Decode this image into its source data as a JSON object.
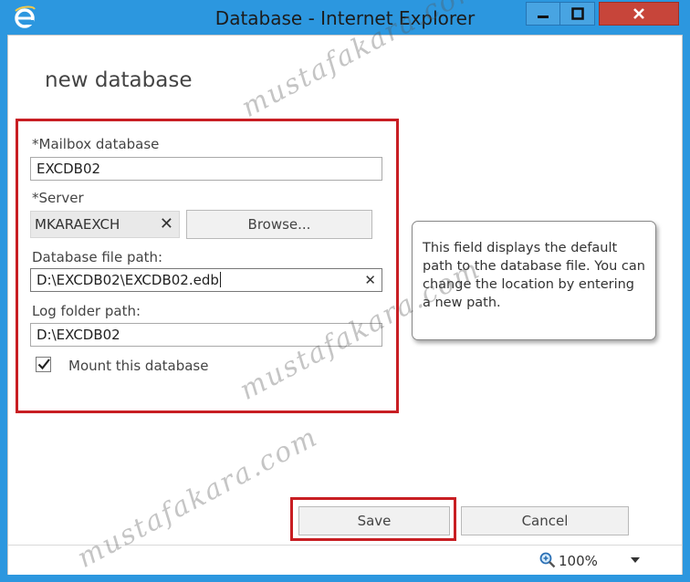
{
  "window": {
    "title": "Database - Internet Explorer"
  },
  "page": {
    "heading": "new database"
  },
  "form": {
    "mailbox_label": "*Mailbox database",
    "mailbox_value": "EXCDB02",
    "server_label": "*Server",
    "server_value": "MKARAEXCH",
    "browse_label": "Browse...",
    "db_path_label": "Database file path:",
    "db_path_value": "D:\\EXCDB02\\EXCDB02.edb",
    "log_path_label": "Log folder path:",
    "log_path_value": "D:\\EXCDB02",
    "mount_label": "Mount this database",
    "mount_checked": true
  },
  "tooltip": {
    "text": "This field displays the default path to the database file. You can change the location by entering a new path."
  },
  "actions": {
    "save_label": "Save",
    "cancel_label": "Cancel"
  },
  "status": {
    "zoom_level": "100%"
  },
  "watermark": {
    "text": "mustafakara.com"
  },
  "colors": {
    "title_bar": "#2c97df",
    "close_button": "#c7453a",
    "highlight_box": "#c81e23"
  }
}
